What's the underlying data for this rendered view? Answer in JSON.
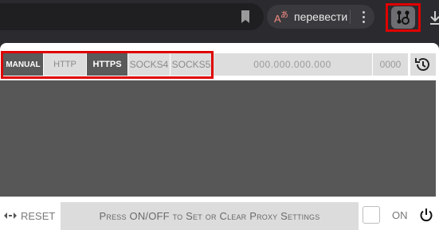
{
  "browser": {
    "translate_label": "перевести"
  },
  "modes": {
    "manual": "MANUAL",
    "http": "HTTP",
    "https": "HTTPS",
    "socks4": "SOCKS4",
    "socks5": "SOCKS5"
  },
  "proxy": {
    "ip_placeholder": "000.000.000.000",
    "port_placeholder": "0000"
  },
  "footer": {
    "reset_label": "RESET",
    "press_label": "Press ON/OFF to Set or Clear Proxy Settings",
    "on_label": "ON"
  },
  "colors": {
    "highlight": "#e00000",
    "active_mode": "#5a5a5a",
    "list_area": "#575757"
  },
  "icons": [
    "bookmark-icon",
    "translate-icon",
    "more-menu-icon",
    "proxy-extension-icon",
    "download-icon",
    "history-icon",
    "reset-icon",
    "power-icon"
  ]
}
